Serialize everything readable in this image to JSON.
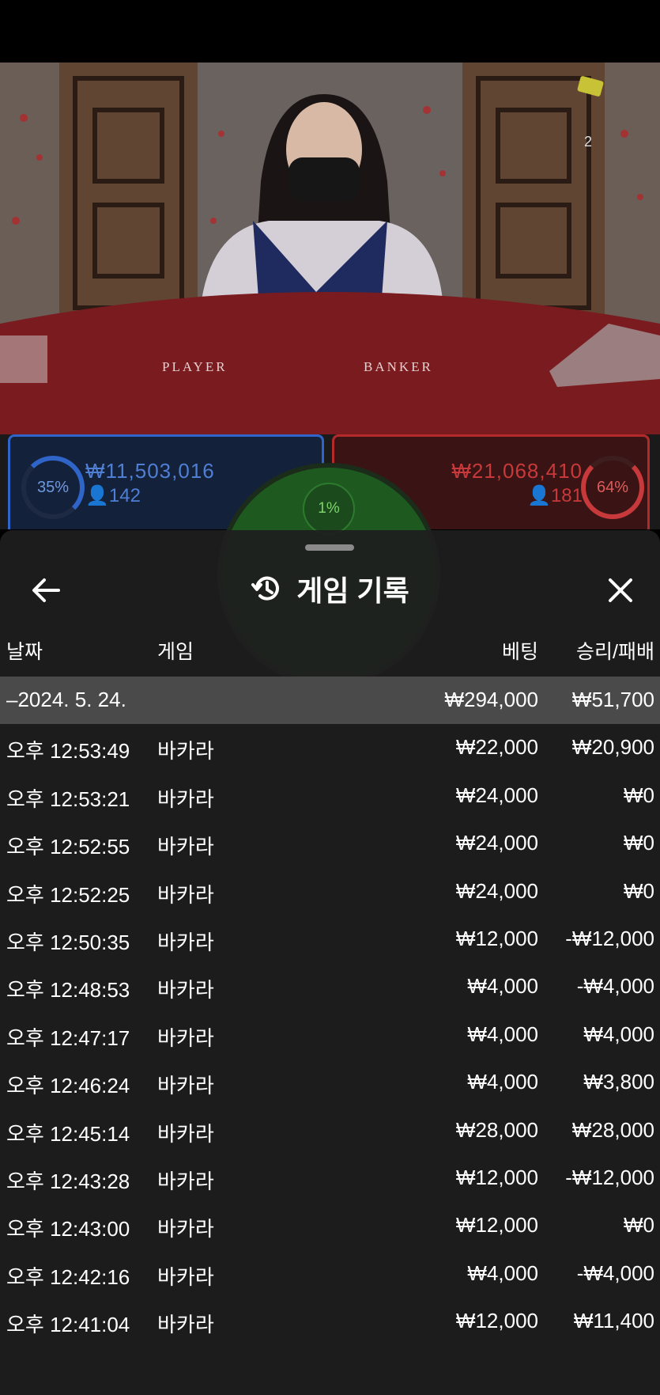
{
  "video": {
    "player_count": "2",
    "table_labels": [
      "PLAYER",
      "BANKER"
    ]
  },
  "bets": {
    "player": {
      "percent": "35%",
      "amount": "₩11,503,016",
      "count": "142"
    },
    "banker": {
      "percent": "64%",
      "amount": "₩21,068,410",
      "count": "181"
    },
    "tie": {
      "percent": "1%"
    }
  },
  "history": {
    "title": "게임 기록",
    "columns": {
      "date": "날짜",
      "game": "게임",
      "bet": "베팅",
      "result": "승리/패배"
    },
    "summary": {
      "date": "–2024. 5. 24.",
      "bet": "₩294,000",
      "result": "₩51,700"
    },
    "rows": [
      {
        "time": "오후 12:53:49",
        "game": "바카라",
        "bet": "₩22,000",
        "result": "₩20,900"
      },
      {
        "time": "오후 12:53:21",
        "game": "바카라",
        "bet": "₩24,000",
        "result": "₩0"
      },
      {
        "time": "오후 12:52:55",
        "game": "바카라",
        "bet": "₩24,000",
        "result": "₩0"
      },
      {
        "time": "오후 12:52:25",
        "game": "바카라",
        "bet": "₩24,000",
        "result": "₩0"
      },
      {
        "time": "오후 12:50:35",
        "game": "바카라",
        "bet": "₩12,000",
        "result": "-₩12,000"
      },
      {
        "time": "오후 12:48:53",
        "game": "바카라",
        "bet": "₩4,000",
        "result": "-₩4,000"
      },
      {
        "time": "오후 12:47:17",
        "game": "바카라",
        "bet": "₩4,000",
        "result": "₩4,000"
      },
      {
        "time": "오후 12:46:24",
        "game": "바카라",
        "bet": "₩4,000",
        "result": "₩3,800"
      },
      {
        "time": "오후 12:45:14",
        "game": "바카라",
        "bet": "₩28,000",
        "result": "₩28,000"
      },
      {
        "time": "오후 12:43:28",
        "game": "바카라",
        "bet": "₩12,000",
        "result": "-₩12,000"
      },
      {
        "time": "오후 12:43:00",
        "game": "바카라",
        "bet": "₩12,000",
        "result": "₩0"
      },
      {
        "time": "오후 12:42:16",
        "game": "바카라",
        "bet": "₩4,000",
        "result": "-₩4,000"
      },
      {
        "time": "오후 12:41:04",
        "game": "바카라",
        "bet": "₩12,000",
        "result": "₩11,400"
      }
    ]
  },
  "colors": {
    "player": "#2f64c8",
    "banker": "#b32a2a",
    "tie": "#1e5a1f",
    "panel": "#1e1e1e",
    "summary_row": "#4a4a4a"
  }
}
